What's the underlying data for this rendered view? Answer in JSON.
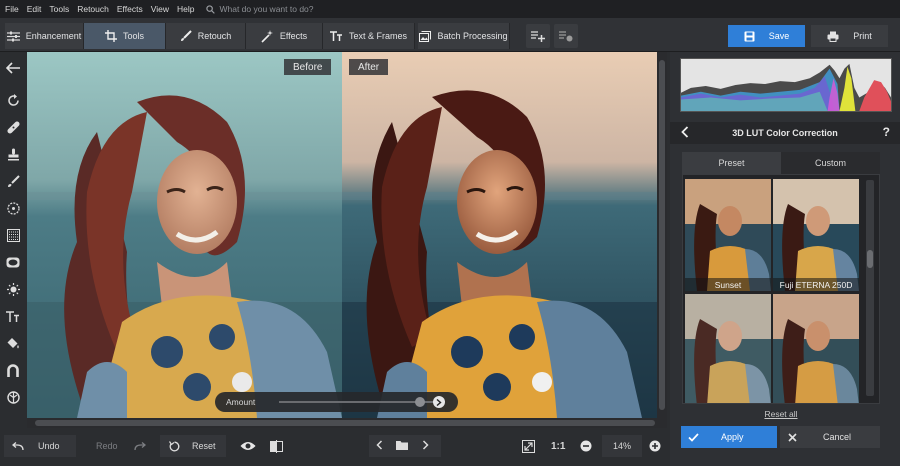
{
  "menu": {
    "items": [
      "File",
      "Edit",
      "Tools",
      "Retouch",
      "Effects",
      "View",
      "Help"
    ],
    "search_placeholder": "What do you want to do?"
  },
  "toolbar": {
    "tabs": [
      {
        "label": "Enhancement",
        "icon": "sliders-icon"
      },
      {
        "label": "Tools",
        "icon": "crop-icon",
        "active": true
      },
      {
        "label": "Retouch",
        "icon": "brush-icon"
      },
      {
        "label": "Effects",
        "icon": "magic-wand-icon"
      },
      {
        "label": "Text & Frames",
        "icon": "text-icon"
      },
      {
        "label": "Batch Processing",
        "icon": "batch-icon"
      }
    ],
    "save_label": "Save",
    "print_label": "Print"
  },
  "canvas": {
    "before_label": "Before",
    "after_label": "After",
    "amount_label": "Amount",
    "amount_value": 0.88
  },
  "bottombar": {
    "undo_label": "Undo",
    "redo_label": "Redo",
    "reset_label": "Reset",
    "ratio_label": "1:1",
    "zoom_value": "14%"
  },
  "panel": {
    "title": "3D LUT Color Correction",
    "help": "?",
    "segments": {
      "preset": "Preset",
      "custom": "Custom"
    },
    "presets": [
      {
        "caption": "Sunset"
      },
      {
        "caption": "Fuji ETERNA 250D"
      },
      {
        "caption": ""
      },
      {
        "caption": ""
      }
    ],
    "reset_all_label": "Reset all",
    "apply_label": "Apply",
    "cancel_label": "Cancel"
  },
  "colors": {
    "accent": "#2f7fd8",
    "active_tab": "#4a5868",
    "background": "#2b2d30"
  }
}
